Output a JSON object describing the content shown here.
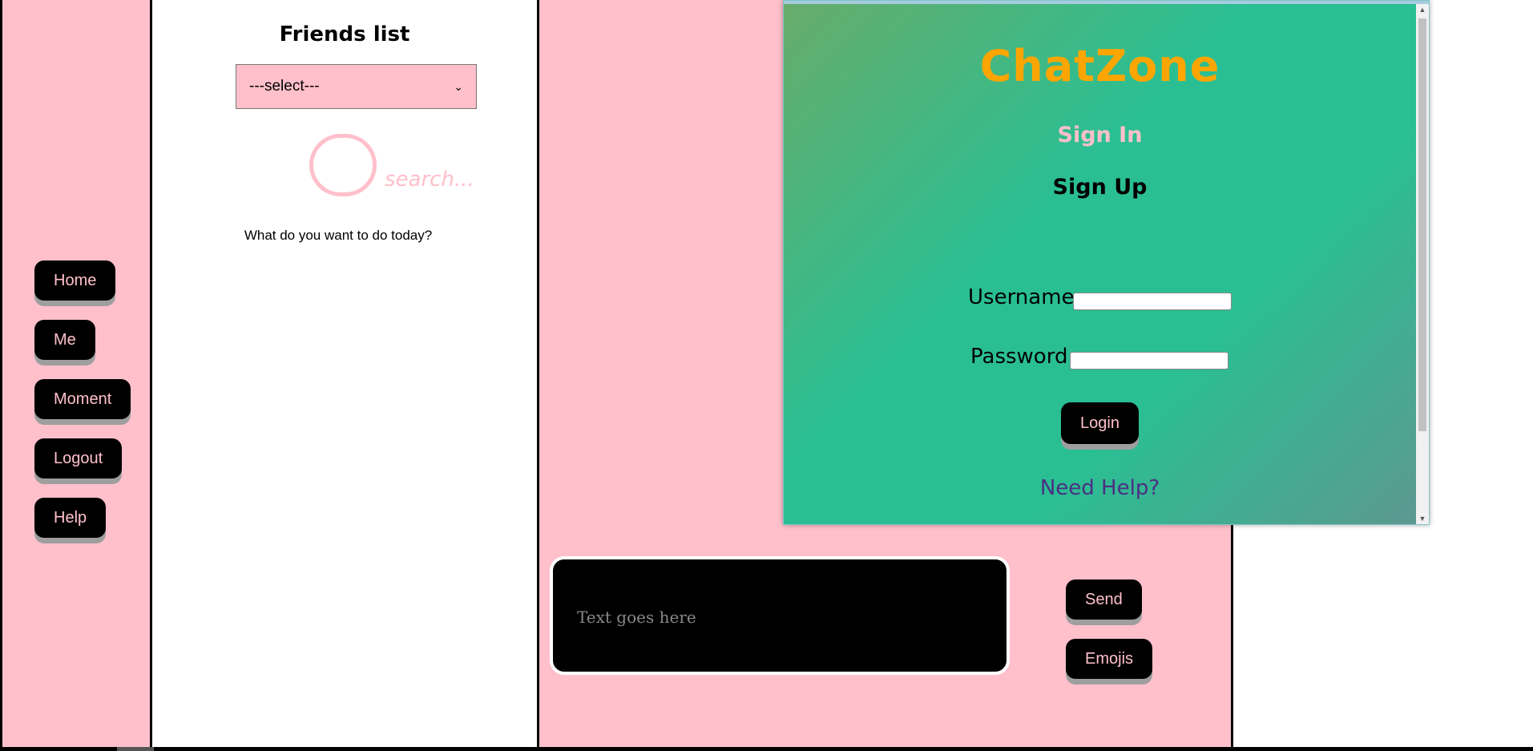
{
  "nav": {
    "items": [
      {
        "label": "Home"
      },
      {
        "label": "Me"
      },
      {
        "label": "Moment"
      },
      {
        "label": "Logout"
      },
      {
        "label": "Help"
      }
    ]
  },
  "friends": {
    "title": "Friends list",
    "select_value": "---select---",
    "search_placeholder": "search...",
    "prompt": "What do you want to do today?"
  },
  "chat": {
    "message_placeholder": "Text goes here",
    "send_label": "Send",
    "emojis_label": "Emojis"
  },
  "login": {
    "brand": "ChatZone",
    "sign_in": "Sign In",
    "sign_up": "Sign Up",
    "username_label": "Username",
    "username_value": "",
    "password_label": "Password",
    "password_value": "",
    "login_button": "Login",
    "help_link": "Need Help?"
  },
  "colors": {
    "pink": "#ffc0cb",
    "black": "#000000",
    "brand_orange": "#ffa500",
    "gradient_green": "#2abf93",
    "help_purple": "#4b2e83"
  }
}
